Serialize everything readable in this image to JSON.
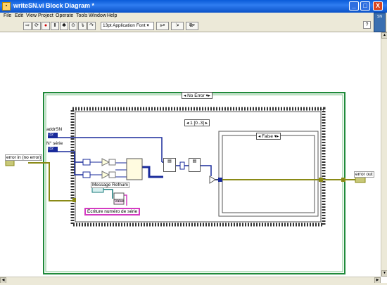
{
  "window": {
    "title": "writeSN.vi Block Diagram *",
    "minimize": "_",
    "maximize": "□",
    "close": "X"
  },
  "menu": [
    "File",
    "Edit",
    "View",
    "Project",
    "Operate",
    "Tools",
    "Window",
    "Help"
  ],
  "toolbar": {
    "font": "13pt Application Font",
    "help": "?"
  },
  "diagram": {
    "case_selector": "No Error",
    "sequence_selector": "1 [0..3]",
    "inner_case_selector": "False",
    "terminals": {
      "error_in": "error in (no error)",
      "error_out": "error out",
      "addr_sn": "addrSN",
      "addr_sn_type": "I32",
      "serial_no": "N° série",
      "serial_no_type": "I32",
      "message_refnum": "Message Refnum",
      "value_label": "Value",
      "comment": "Ecriture numéro de série"
    }
  }
}
